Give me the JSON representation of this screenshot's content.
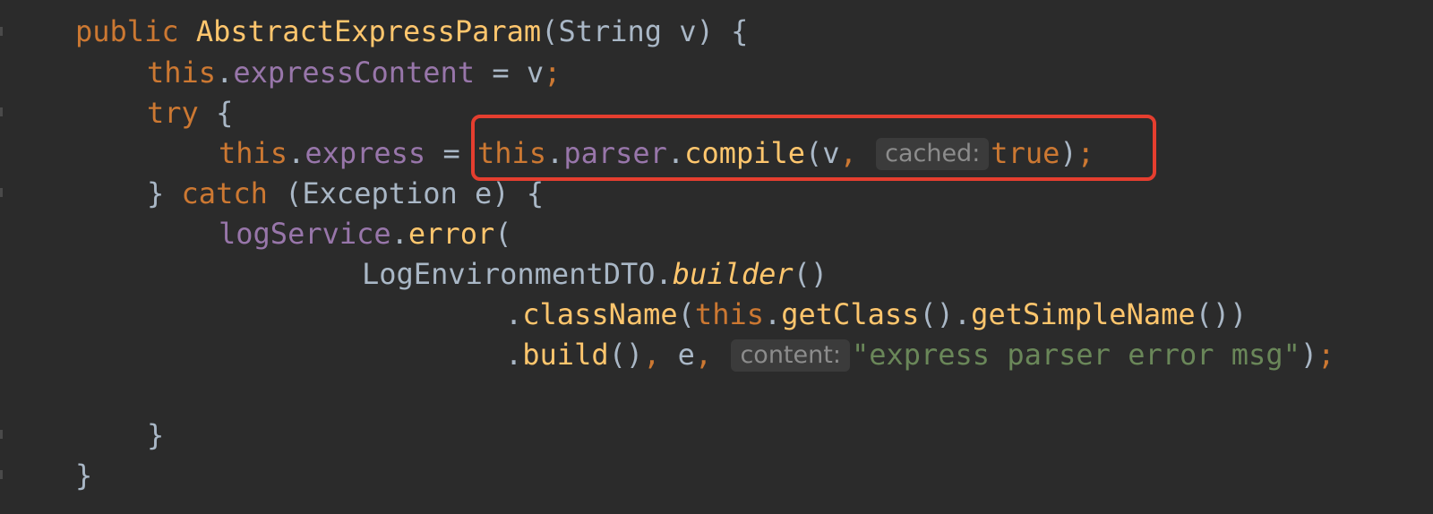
{
  "code": {
    "line1": {
      "kw_public": "public",
      "ctor_name": "AbstractExpressParam",
      "params": "(String v) {"
    },
    "line2": {
      "kw_this": "this",
      "dot": ".",
      "field": "expressContent",
      "rest": " = v",
      "semi": ";"
    },
    "line3": {
      "kw_try": "try",
      "brace": " {"
    },
    "line4": {
      "kw_this": "this",
      "dot": ".",
      "field": "express",
      "assign": " = ",
      "kw_this2": "this",
      "dot2": ".",
      "field2": "parser",
      "dot3": ".",
      "method": "compile",
      "args_open": "(v",
      "comma": ", ",
      "hint_label": "cached:",
      "kw_true": "true",
      "close": ")",
      "semi": ";"
    },
    "line5": {
      "close_brace": "} ",
      "kw_catch": "catch",
      "rest": " (Exception e) {"
    },
    "line6": {
      "field": "logService",
      "dot": ".",
      "method": "error",
      "paren": "("
    },
    "line7": {
      "cls": "LogEnvironmentDTO",
      "dot": ".",
      "method": "builder",
      "parens": "()"
    },
    "line8": {
      "dot": ".",
      "method": "className",
      "paren": "(",
      "kw_this": "this",
      "dot2": ".",
      "method2": "getClass",
      "parens2": "()",
      "dot3": ".",
      "method3": "getSimpleName",
      "parens3": "())"
    },
    "line9": {
      "dot": ".",
      "method": "build",
      "parens": "()",
      "comma": ", ",
      "e": "e",
      "comma2": ", ",
      "hint_label": "content:",
      "string": "\"express parser error msg\"",
      "close": ")",
      "semi": ";"
    },
    "line10": {
      "close_brace": "}"
    },
    "line11": {
      "close_brace": "}"
    }
  },
  "colors": {
    "background": "#2b2b2b",
    "keyword": "#cc7832",
    "method": "#ffc66d",
    "field": "#9876aa",
    "plain": "#a9b7c6",
    "string": "#6a8759",
    "highlight_box": "#e53e2f"
  }
}
